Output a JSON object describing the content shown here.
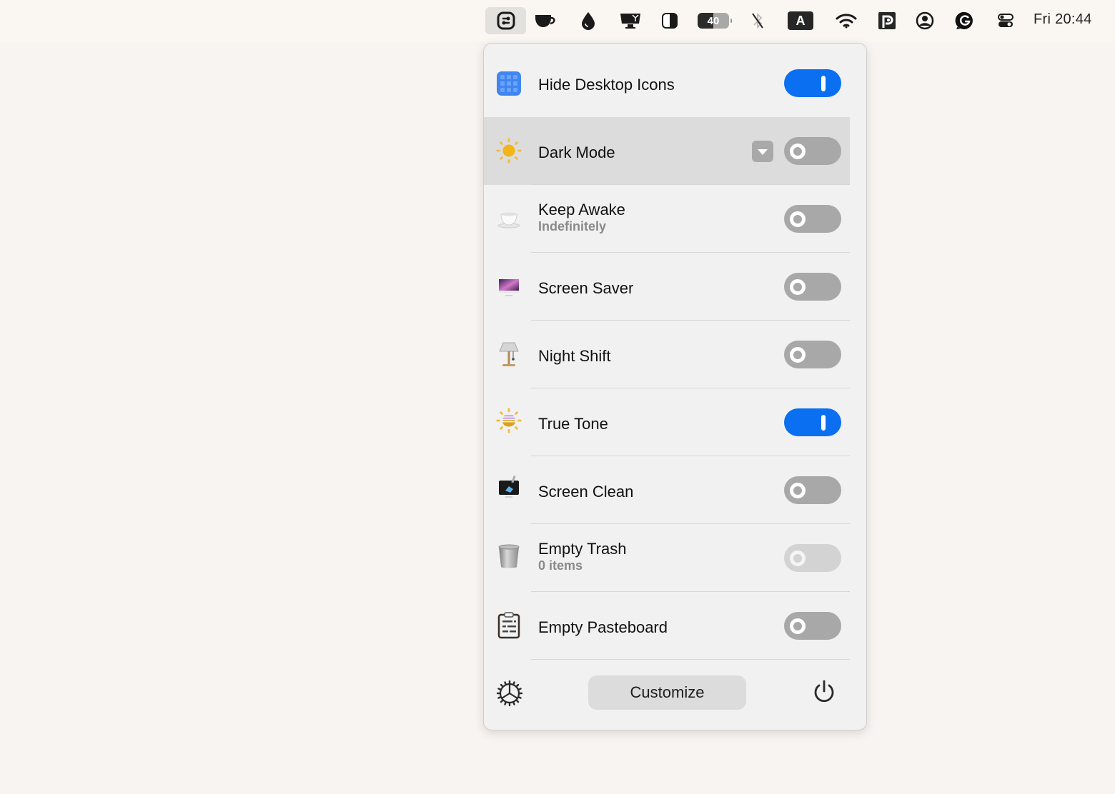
{
  "menubar": {
    "items": [
      {
        "name": "control-center-app-icon",
        "active": true
      },
      {
        "name": "coffee-cup-icon"
      },
      {
        "name": "drop-icon"
      },
      {
        "name": "display-icon"
      },
      {
        "name": "contrast-icon"
      },
      {
        "name": "battery-icon",
        "text": "40"
      },
      {
        "name": "bluetooth-off-icon"
      },
      {
        "name": "input-source-icon",
        "text": "A"
      },
      {
        "name": "wifi-icon"
      },
      {
        "name": "p-app-icon"
      },
      {
        "name": "user-icon"
      },
      {
        "name": "grammarly-icon"
      },
      {
        "name": "control-center-icon"
      }
    ],
    "clock": "Fri 20:44"
  },
  "panel": {
    "rows": [
      {
        "label": "Hide Desktop Icons",
        "sub": null,
        "state": "on",
        "icon": "grid-icon"
      },
      {
        "label": "Dark Mode",
        "sub": null,
        "state": "off",
        "icon": "sun-icon",
        "highlighted": true,
        "has_dropdown": true
      },
      {
        "label": "Keep Awake",
        "sub": "Indefinitely",
        "state": "off",
        "icon": "teacup-icon"
      },
      {
        "label": "Screen Saver",
        "sub": null,
        "state": "off",
        "icon": "monitor-icon"
      },
      {
        "label": "Night Shift",
        "sub": null,
        "state": "off",
        "icon": "lamp-icon"
      },
      {
        "label": "True Tone",
        "sub": null,
        "state": "on",
        "icon": "true-tone-icon"
      },
      {
        "label": "Screen Clean",
        "sub": null,
        "state": "off",
        "icon": "screen-clean-icon"
      },
      {
        "label": "Empty Trash",
        "sub": "0 items",
        "state": "disabled",
        "icon": "trash-icon"
      },
      {
        "label": "Empty Pasteboard",
        "sub": null,
        "state": "off",
        "icon": "clipboard-icon"
      }
    ],
    "footer": {
      "customize_label": "Customize"
    }
  },
  "colors": {
    "accent": "#0a6ff0",
    "toggle_off": "#a8a8a8",
    "toggle_disabled": "#d3d3d3"
  }
}
